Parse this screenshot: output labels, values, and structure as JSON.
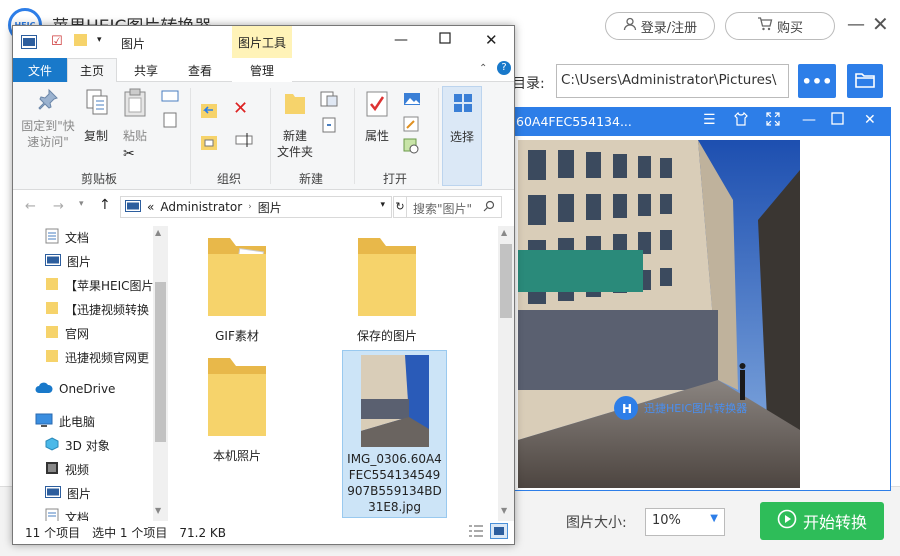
{
  "bg_app": {
    "title": "苹果HEIC图片转换器",
    "logo_text": "HEIC",
    "login_label": "登录/注册",
    "buy_label": "购买",
    "dir_label": "目录:",
    "dir_value": "C:\\Users\\Administrator\\Pictures\\",
    "more_label": "•••",
    "size_label": "图片大小:",
    "size_value": "10%",
    "start_label": "开始转换"
  },
  "viewer": {
    "title": "60A4FEC554134...",
    "watermark": "迅捷HEIC图片转换器"
  },
  "explorer": {
    "qat_title": "图片",
    "tool_tab": "图片工具",
    "tabs": [
      "文件",
      "主页",
      "共享",
      "查看",
      "管理"
    ],
    "ribbon": {
      "pin_label": "固定到\"快\n速访问\"",
      "copy_label": "复制",
      "paste_label": "粘贴",
      "clipboard_group": "剪贴板",
      "organize_group": "组织",
      "new_folder_label": "新建\n文件夹",
      "new_group": "新建",
      "properties_label": "属性",
      "open_group": "打开",
      "select_label": "选择"
    },
    "address": {
      "prefix": "«",
      "crumbs": [
        "Administrator",
        "图片"
      ],
      "search_placeholder": "搜索\"图片\""
    },
    "nav_items": [
      {
        "label": "文档",
        "icon": "document-icon"
      },
      {
        "label": "图片",
        "icon": "picture-icon"
      },
      {
        "label": "【苹果HEIC图片",
        "icon": "folder-icon"
      },
      {
        "label": "【迅捷视频转换",
        "icon": "folder-icon"
      },
      {
        "label": "官网",
        "icon": "folder-icon"
      },
      {
        "label": "迅捷视频官网更",
        "icon": "folder-icon"
      },
      {
        "label": "OneDrive",
        "icon": "onedrive-icon"
      },
      {
        "label": "此电脑",
        "icon": "computer-icon"
      },
      {
        "label": "3D 对象",
        "icon": "3d-objects-icon"
      },
      {
        "label": "视频",
        "icon": "video-icon"
      },
      {
        "label": "图片",
        "icon": "picture-icon"
      },
      {
        "label": "文档",
        "icon": "document-icon"
      }
    ],
    "files": [
      {
        "name": "GIF素材"
      },
      {
        "name": "保存的图片"
      },
      {
        "name": "本机照片"
      },
      {
        "name": "IMG_0306.60A4FEC554134549907B559134BD31E8.jpg"
      }
    ],
    "status": {
      "count": "11 个项目",
      "selected": "选中 1 个项目",
      "size": "71.2 KB"
    }
  },
  "colors": {
    "accent_blue": "#2d7ee8",
    "file_tab_blue": "#1979ca",
    "start_green": "#2ebd59",
    "folder_yellow": "#f6d36b"
  }
}
